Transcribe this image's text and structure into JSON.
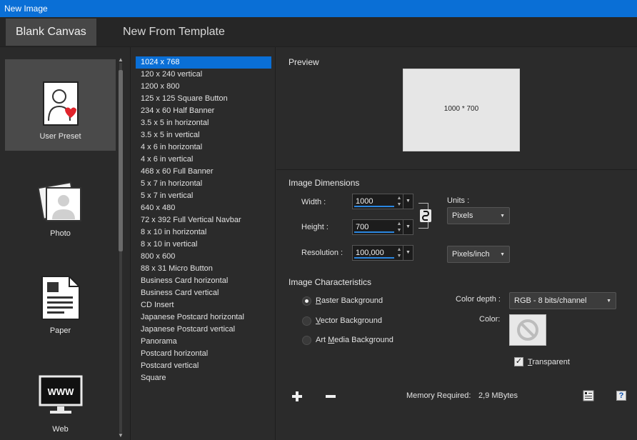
{
  "window": {
    "title": "New Image"
  },
  "tabs": [
    {
      "label": "Blank Canvas",
      "active": true
    },
    {
      "label": "New From Template",
      "active": false
    }
  ],
  "presets": [
    {
      "label": "User Preset",
      "icon": "user-preset-icon",
      "active": true
    },
    {
      "label": "Photo",
      "icon": "photo-icon",
      "active": false
    },
    {
      "label": "Paper",
      "icon": "paper-icon",
      "active": false
    },
    {
      "label": "Web",
      "icon": "web-icon",
      "active": false
    }
  ],
  "templates": [
    "1024 x 768",
    "120 x 240 vertical",
    "1200 x 800",
    "125 x 125 Square Button",
    "234 x 60 Half Banner",
    "3.5 x 5 in horizontal",
    "3.5 x 5 in vertical",
    "4 x 6 in horizontal",
    "4 x 6 in vertical",
    "468 x 60 Full Banner",
    "5 x 7 in horizontal",
    "5 x 7 in vertical",
    "640 x 480",
    "72 x 392 Full Vertical Navbar",
    "8 x 10 in horizontal",
    "8 x 10 in vertical",
    "800 x 600",
    "88 x 31 Micro Button",
    "Business Card horizontal",
    "Business Card vertical",
    "CD Insert",
    "Japanese Postcard horizontal",
    "Japanese Postcard vertical",
    "Panorama",
    "Postcard horizontal",
    "Postcard vertical",
    "Square"
  ],
  "selected_template_index": 0,
  "preview": {
    "title": "Preview",
    "text": "1000 * 700"
  },
  "dimensions": {
    "title": "Image Dimensions",
    "width_label": "Width :",
    "width_value": "1000",
    "height_label": "Height :",
    "height_value": "700",
    "resolution_label": "Resolution :",
    "resolution_value": "100,000",
    "units_label": "Units :",
    "units_value": "Pixels",
    "res_units_value": "Pixels/inch"
  },
  "characteristics": {
    "title": "Image Characteristics",
    "options": [
      {
        "pre": "",
        "key": "R",
        "post": "aster Background",
        "selected": true
      },
      {
        "pre": "",
        "key": "V",
        "post": "ector Background",
        "selected": false
      },
      {
        "pre": "Art ",
        "key": "M",
        "post": "edia Background",
        "selected": false
      }
    ],
    "color_depth_label": "Color depth :",
    "color_depth_value": "RGB - 8 bits/channel",
    "color_label": "Color:",
    "transparent": {
      "pre": "",
      "key": "T",
      "post": "ransparent",
      "checked": true
    }
  },
  "footer": {
    "memory_label": "Memory Required:",
    "memory_value": "2,9 MBytes",
    "add_icon": "plus-icon",
    "remove_icon": "minus-icon",
    "help_label": "?"
  }
}
